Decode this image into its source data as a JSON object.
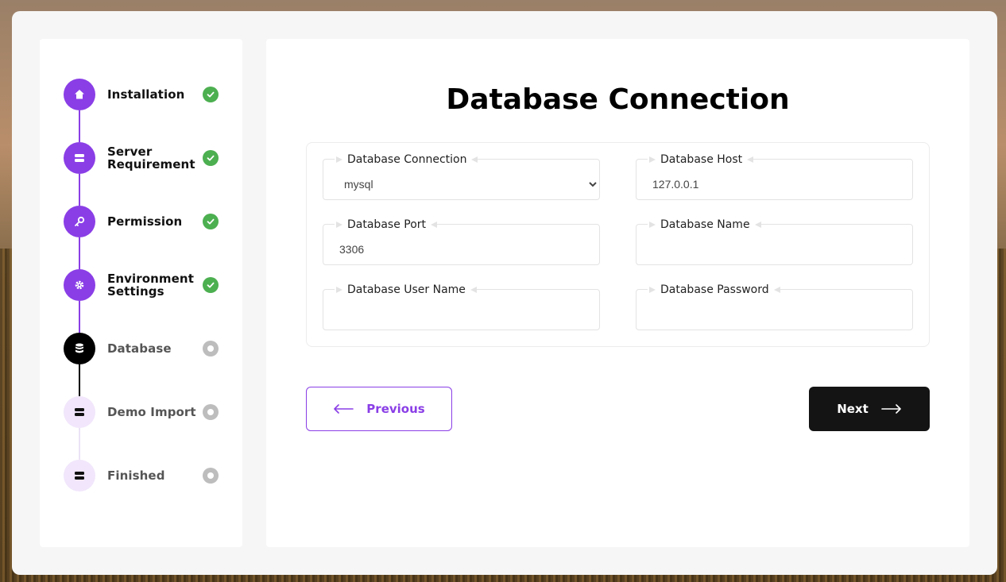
{
  "colors": {
    "accent": "#8a3ee6",
    "success": "#4caf50",
    "pending": "#bdbdbd",
    "active": "#000000",
    "next_button": "#141414"
  },
  "sidebar": {
    "steps": [
      {
        "label": "Installation",
        "state": "done",
        "icon": "home-icon"
      },
      {
        "label": "Server Requirement",
        "state": "done",
        "icon": "server-icon"
      },
      {
        "label": "Permission",
        "state": "done",
        "icon": "key-icon"
      },
      {
        "label": "Environment Settings",
        "state": "done",
        "icon": "gear-icon"
      },
      {
        "label": "Database",
        "state": "active",
        "icon": "database-icon"
      },
      {
        "label": "Demo Import",
        "state": "pending",
        "icon": "server-icon"
      },
      {
        "label": "Finished",
        "state": "pending",
        "icon": "server-icon"
      }
    ]
  },
  "main": {
    "title": "Database Connection",
    "fields": {
      "connection": {
        "label": "Database Connection",
        "value": "mysql",
        "options": [
          "mysql"
        ]
      },
      "host": {
        "label": "Database Host",
        "value": "127.0.0.1"
      },
      "port": {
        "label": "Database Port",
        "value": "3306"
      },
      "name": {
        "label": "Database Name",
        "value": ""
      },
      "username": {
        "label": "Database User Name",
        "value": ""
      },
      "password": {
        "label": "Database Password",
        "value": ""
      }
    },
    "buttons": {
      "previous": "Previous",
      "next": "Next"
    }
  }
}
